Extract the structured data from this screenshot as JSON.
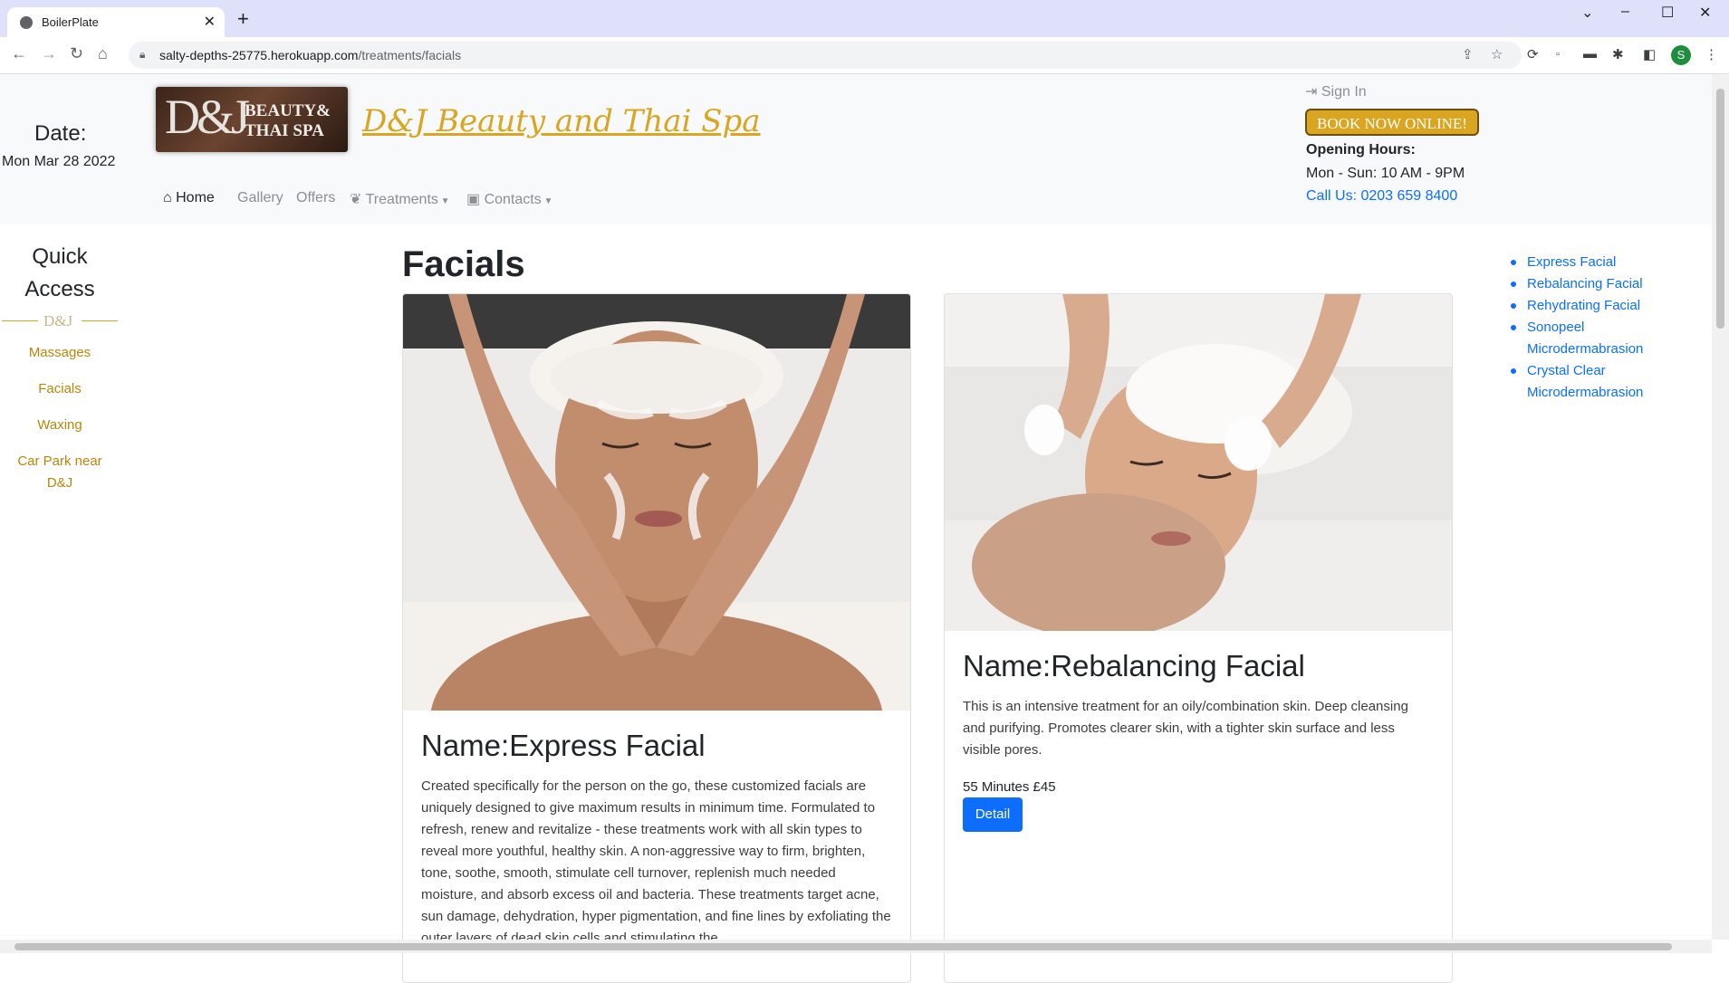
{
  "browser": {
    "tab_title": "BoilerPlate",
    "url_host": "salty-depths-25775.herokuapp.com",
    "url_path": "/treatments/facials",
    "profile_initial": "S"
  },
  "header": {
    "date_label": "Date:",
    "date_value": "Mon Mar 28 2022",
    "logo_mono": "D&J",
    "logo_line1": "BEAUTY&",
    "logo_line2": "THAI SPA",
    "site_title": " D&J Beauty and Thai Spa",
    "sign_in": "Sign In",
    "book_now": "BOOK NOW ONLINE!",
    "hours_title": "Opening Hours:",
    "hours_value": "Mon - Sun: 10 AM - 9PM",
    "call": "Call Us: 0203 659 8400"
  },
  "nav": {
    "home": "Home",
    "gallery": "Gallery",
    "offers": "Offers",
    "treatments": "Treatments",
    "contacts": "Contacts"
  },
  "quick_access": {
    "title": "Quick Access",
    "mark": "D&J",
    "links": [
      "Massages",
      "Facials",
      "Waxing",
      "Car Park near D&J"
    ]
  },
  "main": {
    "heading": "Facials",
    "cards": [
      {
        "name": "Name:Express Facial",
        "description": "Created specifically for the person on the go, these customized facials are uniquely designed to give maximum results in minimum time. Formulated to refresh, renew and revitalize - these treatments work with all skin types to reveal more youthful, healthy skin. A non-aggressive way to firm, brighten, tone, soothe, smooth, stimulate cell turnover, replenish much needed moisture, and absorb excess oil and bacteria. These treatments target acne, sun damage, dehydration, hyper pigmentation, and fine lines by exfoliating the outer layers of dead skin cells and stimulating the"
      },
      {
        "name": "Name:Rebalancing Facial",
        "description": "This is an intensive treatment for an oily/combination skin. Deep cleansing and purifying. Promotes clearer skin, with a tighter skin surface and less visible pores.",
        "price": "55 Minutes £45",
        "button": "Detail"
      }
    ]
  },
  "toc": [
    "Express Facial",
    "Rebalancing Facial",
    "Rehydrating Facial",
    "Sonopeel Microdermabrasion",
    "Crystal Clear Microdermabrasion"
  ],
  "colors": {
    "accent_gold": "#daa520",
    "link_blue": "#0d6efd",
    "header_bg": "#f8f9fa"
  }
}
